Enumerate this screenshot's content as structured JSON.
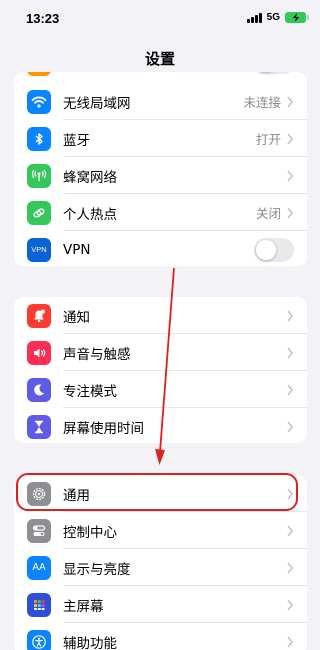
{
  "status_bar": {
    "time": "13:23",
    "network": "5G"
  },
  "nav": {
    "title": "设置"
  },
  "group1": [
    {
      "label": "无线局域网",
      "value": "未连接",
      "icon": "wifi-icon",
      "color": "#0a84ff"
    },
    {
      "label": "蓝牙",
      "value": "打开",
      "icon": "bluetooth-icon",
      "color": "#0a84ff"
    },
    {
      "label": "蜂窝网络",
      "value": "",
      "icon": "cellular-icon",
      "color": "#34c759"
    },
    {
      "label": "个人热点",
      "value": "关闭",
      "icon": "hotspot-icon",
      "color": "#34c759"
    },
    {
      "label": "VPN",
      "value": "",
      "icon": "vpn-icon",
      "color": "#0a64d8",
      "icon_text": "VPN",
      "toggle": false
    }
  ],
  "group2": [
    {
      "label": "通知",
      "icon": "notification-icon",
      "color": "#ff3b30"
    },
    {
      "label": "声音与触感",
      "icon": "sound-icon",
      "color": "#ff2d55"
    },
    {
      "label": "专注模式",
      "icon": "moon-icon",
      "color": "#5e5ce6"
    },
    {
      "label": "屏幕使用时间",
      "icon": "hourglass-icon",
      "color": "#5e5ce6"
    }
  ],
  "group3": [
    {
      "label": "通用",
      "icon": "gear-icon",
      "color": "#8e8e93"
    },
    {
      "label": "控制中心",
      "icon": "control-center-icon",
      "color": "#8e8e93"
    },
    {
      "label": "显示与亮度",
      "icon": "display-icon",
      "color": "#0a84ff",
      "icon_text": "AA"
    },
    {
      "label": "主屏幕",
      "icon": "home-screen-icon",
      "color": "#2f4fd8"
    },
    {
      "label": "辅助功能",
      "icon": "accessibility-icon",
      "color": "#0a84ff"
    }
  ]
}
